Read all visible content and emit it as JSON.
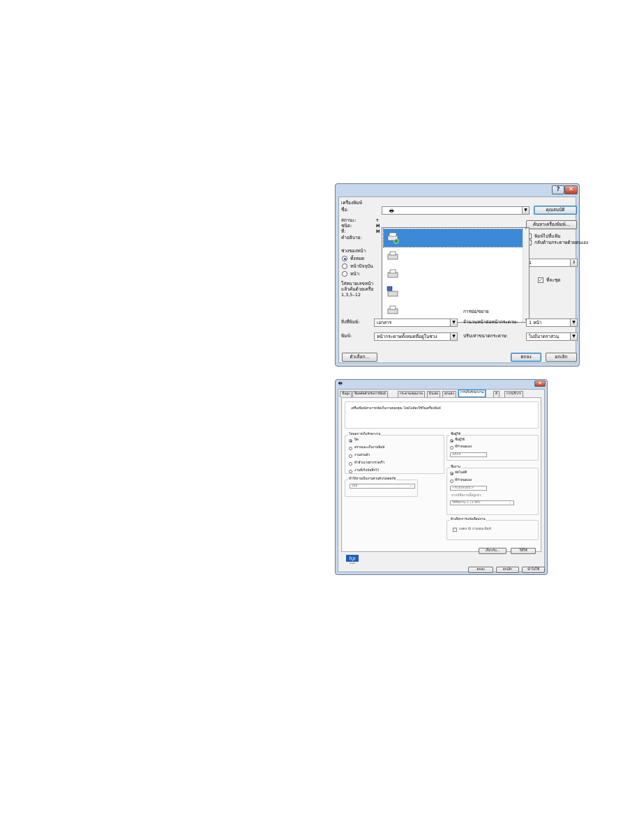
{
  "print": {
    "close_glyph": "✕",
    "help_glyph": "?",
    "printer_group_label": "เครื่องพิมพ์",
    "name_label": "ชื่อ:",
    "status_label": "สถานะ:",
    "type_label": "ชนิด:",
    "where_label": "ที่:",
    "comment_label": "คำอธิบาย:",
    "status_value_fragment": "ร",
    "type_value_fragment": "H",
    "where_value_fragment": "H",
    "properties_button": "คุณสมบัติ",
    "find_printer_button": "ค้นหาเครื่องพิมพ์...",
    "print_to_file_label": "พิมพ์ไปที่แฟ้ม",
    "manual_duplex_label": "กลับด้านกระดาษด้วยตนเอง",
    "page_range_label": "ช่วงของหน้า",
    "range_all": "ทั้งหมด",
    "range_current": "หน้าปัจจุบัน",
    "range_pages": "หน้า:",
    "range_hint_1": "ใส่หมายเลขหน้า",
    "range_hint_2": "แล้วคั่นด้วยเครื่อ",
    "range_hint_3": "1,3,5–12",
    "copies_value": "1",
    "collate_label": "ที่ละชุด",
    "zoom_label": "การย่อ/ขยาย",
    "print_what_label": "สิ่งที่พิมพ์:",
    "print_what_value": "เอกสาร",
    "print_label": "พิมพ์:",
    "print_value": "หน้ากระดาษทั้งหมดที่อยู่ในช่วง",
    "pages_per_sheet_label": "จำนวนหน้าต่อหน้ากระดาษ:",
    "pages_per_sheet_value": "1 หน้า",
    "scale_label": "ปรับเท่าขนาดกระดาษ:",
    "scale_value": "ไม่มีมาตราส่วน",
    "options_button": "ตัวเลือก...",
    "ok_button": "ตกลง",
    "cancel_button": "ยกเลิก"
  },
  "props": {
    "close_glyph": "✕",
    "tabs": [
      "ขั้นสูง",
      "ช็อตคัตสำหรับการพิมพ์",
      "กระดาษ/คุณภาพ",
      "ผิวแต่ง",
      "ตกแต่ง",
      "การเก็บรักษางาน",
      "สี",
      "การบริการ"
    ],
    "description": "เครื่องพิมพ์สามารถจัดเก็บงานของคุณ โดยไม่ต้องใช้ในเครื่องพิมพ์",
    "job_storage_mode_label": "โหมดการเก็บรักษางาน",
    "mode_off": "ปิด",
    "mode_proof": "ตรวจและเก็บงานพิมพ์",
    "mode_personal": "งานส่วนตัว",
    "mode_quick": "ทำสำเนาอย่างรวดเร็ว",
    "mode_stored": "งานที่เก็บบันทึกไว้",
    "private_job_label": "ทำให้งานเป็นงานส่วนตัว/ปลอดภัย",
    "private_job_value": "ไม่มี",
    "user_name_label": "ชื่อผู้ใช้",
    "user_name_default": "ชื่อผู้ใช้",
    "user_name_custom": "ที่กำหนดเอง",
    "user_name_value": "XXXX",
    "job_name_label": "ชื่องาน",
    "job_name_auto": "อัตโนมัติ",
    "job_name_custom": "ที่กำหนดเอง",
    "job_name_value": "<Automatic>",
    "job_name_exists_label": "หากมีชื่องานนี้อยู่แล้ว:",
    "job_name_exists_value": "ใช้ชื่องาน + (1-99)",
    "notification_label": "ตัวเลือกการแจ้งเตือนงาน",
    "notification_check": "แสดง ID งานขณะพิมพ์",
    "about_button": "เกี่ยวกับ...",
    "help_button": "วิธีใช้",
    "ok_button": "ตกลง",
    "cancel_button": "ยกเลิก",
    "apply_button": "นำไปใช้",
    "hp_logo_text": "hp",
    "hp_tagline": "invent"
  }
}
